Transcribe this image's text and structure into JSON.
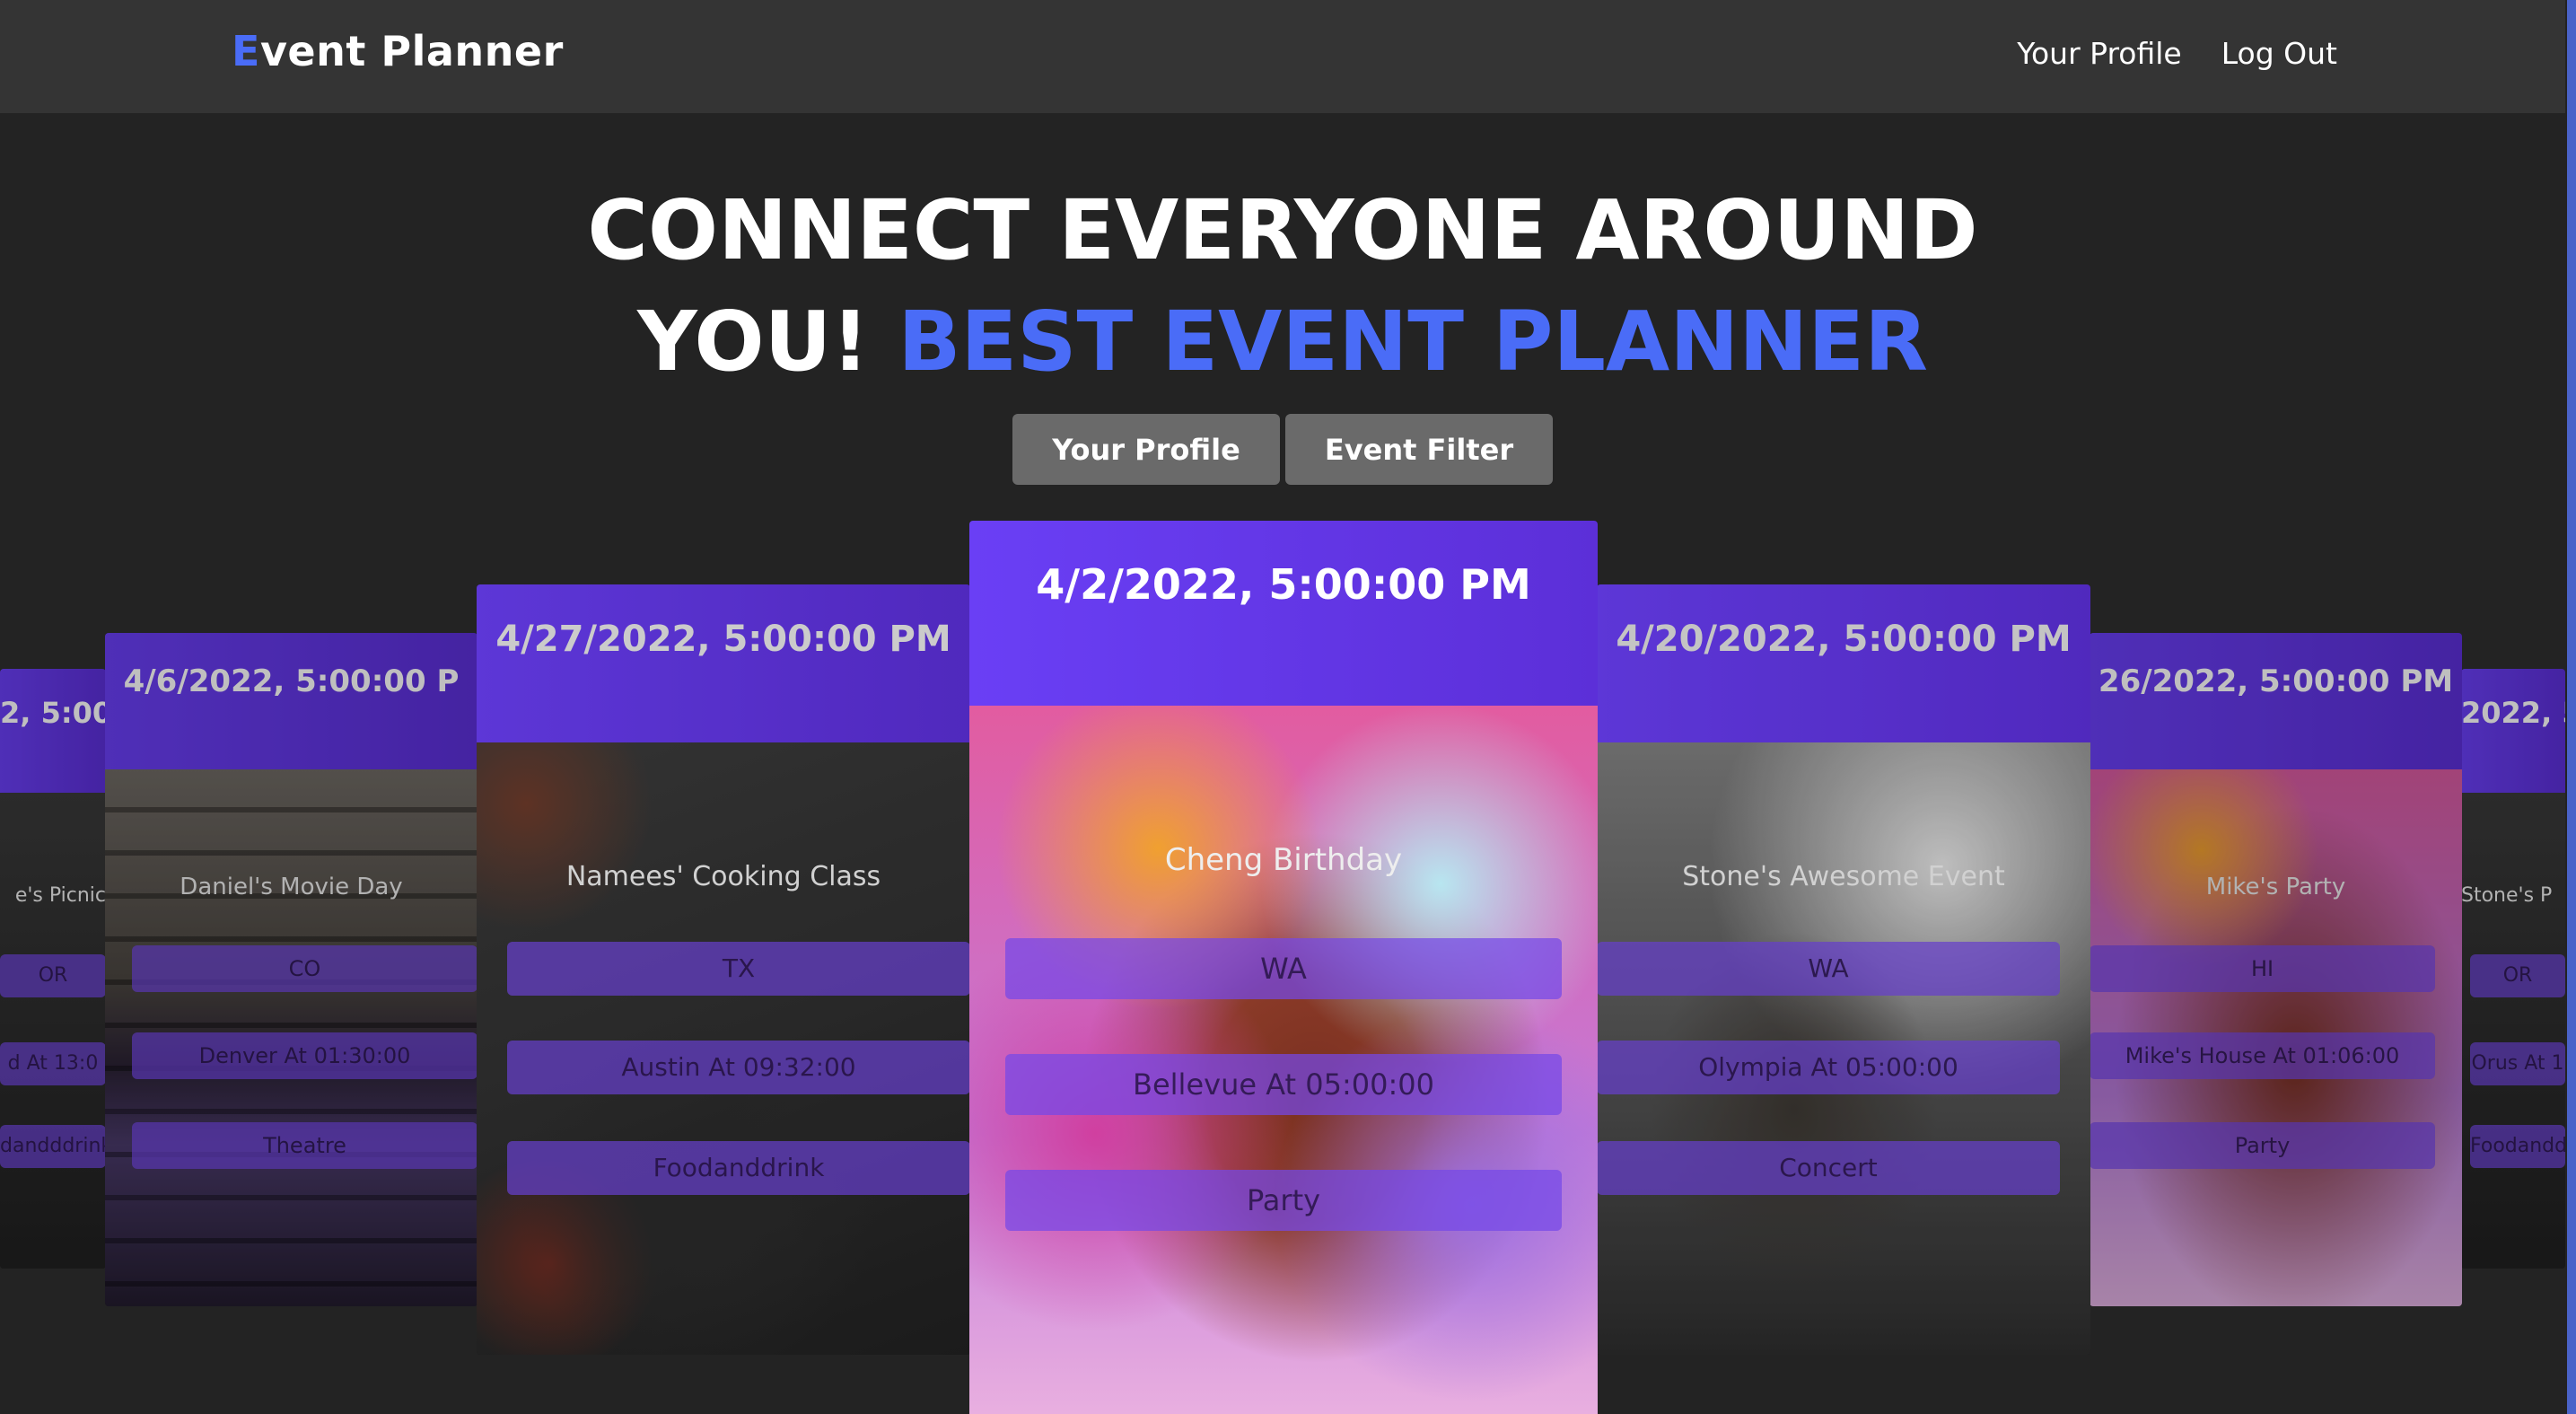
{
  "navbar": {
    "brand_first": "E",
    "brand_rest": "vent Planner",
    "links": [
      "Your Profile",
      "Log Out"
    ]
  },
  "hero": {
    "line1": "CONNECT EVERYONE AROUND",
    "line2_white": "YOU! ",
    "line2_accent": "BEST EVENT PLANNER",
    "buttons": [
      "Your Profile",
      "Event Filter"
    ]
  },
  "colors": {
    "accent": "#4a6cf7",
    "card_header": "#6a3ff5",
    "background": "#232323",
    "navbar": "#343434"
  },
  "cards": {
    "l3": {
      "date": "2, 5:00:",
      "title": "e's Picnic",
      "state": "OR",
      "location": "d At 13:0",
      "category": "dandddrink"
    },
    "l2": {
      "date": "4/6/2022, 5:00:00 P",
      "title": "Daniel's Movie Day",
      "state": "CO",
      "location": "Denver At 01:30:00",
      "category": "Theatre"
    },
    "l1": {
      "date": "4/27/2022, 5:00:00 PM",
      "title": "Namees' Cooking Class",
      "state": "TX",
      "location": "Austin At 09:32:00",
      "category": "Foodanddrink"
    },
    "center": {
      "date": "4/2/2022, 5:00:00 PM",
      "title": "Cheng Birthday",
      "state": "WA",
      "location": "Bellevue At 05:00:00",
      "category": "Party"
    },
    "r1": {
      "date": "4/20/2022, 5:00:00 PM",
      "title": "Stone's Awesome Event",
      "state": "WA",
      "location": "Olympia At 05:00:00",
      "category": "Concert"
    },
    "r2": {
      "date": "26/2022, 5:00:00 PM",
      "title": "Mike's Party",
      "state": "HI",
      "location": "Mike's House At 01:06:00",
      "category": "Party"
    },
    "r3": {
      "date": "2022, 5:",
      "title": "Stone's P",
      "state": "OR",
      "location": "Orus At 1",
      "category": "Foodandd"
    }
  }
}
